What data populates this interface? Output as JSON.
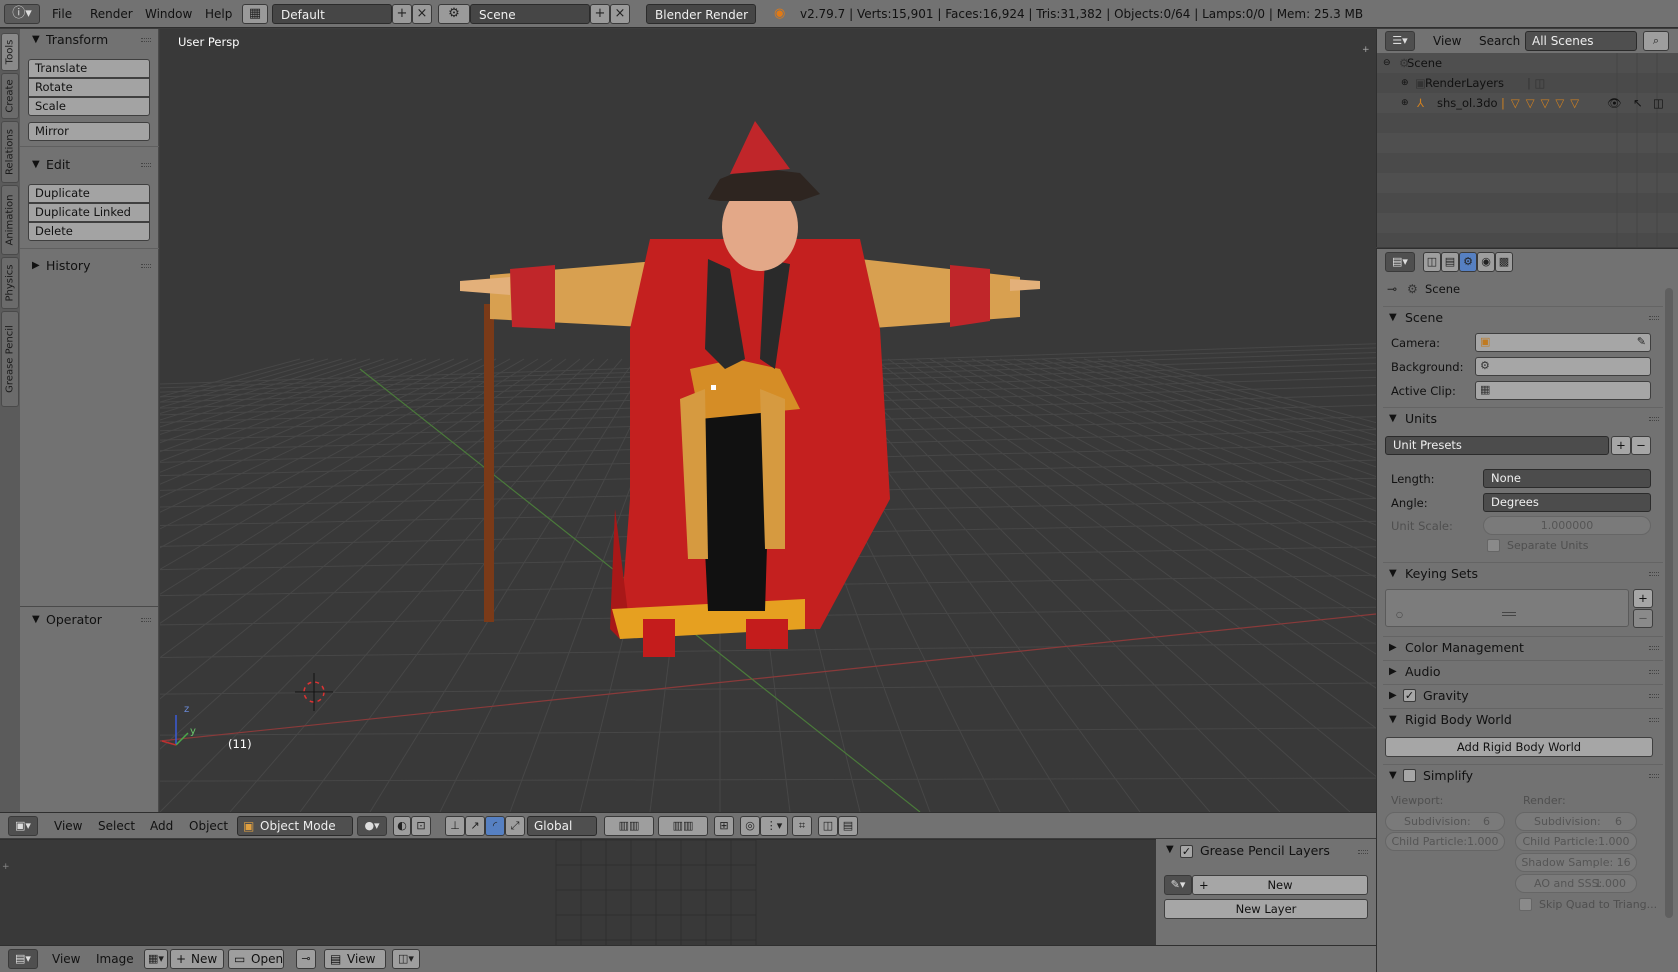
{
  "topbar": {
    "menus": [
      "File",
      "Render",
      "Window",
      "Help"
    ],
    "layout": "Default",
    "scene": "Scene",
    "engine": "Blender Render",
    "stats": "v2.79.7 | Verts:15,901 | Faces:16,924 | Tris:31,382 | Objects:0/64 | Lamps:0/0 | Mem: 25.3 MB"
  },
  "tooltabs": [
    "Tools",
    "Create",
    "Relations",
    "Animation",
    "Physics",
    "Grease Pencil"
  ],
  "toolshelf": {
    "transform": "Transform",
    "translate": "Translate",
    "rotate": "Rotate",
    "scale": "Scale",
    "mirror": "Mirror",
    "edit": "Edit",
    "duplicate": "Duplicate",
    "duplicate_linked": "Duplicate Linked",
    "delete": "Delete",
    "history": "History",
    "operator": "Operator"
  },
  "viewport": {
    "view_name": "User Persp",
    "frame": "(11)",
    "axis_z": "z",
    "axis_y": "y",
    "colors": {
      "bg": "#393939",
      "grid": "#474747",
      "x_axis": "#8a3a3a",
      "y_axis": "#4a7a3a"
    }
  },
  "v3dheader": {
    "view": "View",
    "select": "Select",
    "add": "Add",
    "object": "Object",
    "mode": "Object Mode",
    "orientation": "Global"
  },
  "gplayers": {
    "title": "Grease Pencil Layers",
    "new": "New",
    "new_layer": "New Layer"
  },
  "imgheader": {
    "view": "View",
    "image": "Image",
    "new": "New",
    "open": "Open",
    "view2": "View"
  },
  "outliner": {
    "view": "View",
    "search": "Search",
    "scenes": "All Scenes",
    "rows": [
      "Scene",
      "RenderLayers",
      "shs_ol.3do"
    ]
  },
  "properties": {
    "context": "Scene",
    "scene_panel": "Scene",
    "camera_label": "Camera:",
    "background_label": "Background:",
    "active_clip_label": "Active Clip:",
    "units_panel": "Units",
    "unit_presets": "Unit Presets",
    "length_label": "Length:",
    "length_value": "None",
    "angle_label": "Angle:",
    "angle_value": "Degrees",
    "unit_scale_label": "Unit Scale:",
    "unit_scale_value": "1.000000",
    "separate_units": "Separate Units",
    "keying_sets": "Keying Sets",
    "color_management": "Color Management",
    "audio": "Audio",
    "gravity": "Gravity",
    "rigid_body_world": "Rigid Body World",
    "add_rigid_body_world": "Add Rigid Body World",
    "simplify": "Simplify",
    "viewport_label": "Viewport:",
    "render_label": "Render:",
    "vp_subdivision": "Subdivision:",
    "vp_subdivision_value": "6",
    "vp_child_particle": "Child Particle:1.000",
    "r_subdivision": "Subdivision:",
    "r_subdivision_value": "6",
    "r_child_particle": "Child Particle:1.000",
    "r_shadow_sample": "Shadow Sample: 16",
    "r_ao_sss": "AO and SSS:",
    "r_ao_sss_value": "1.000",
    "skip_quad": "Skip Quad to Triang..."
  }
}
